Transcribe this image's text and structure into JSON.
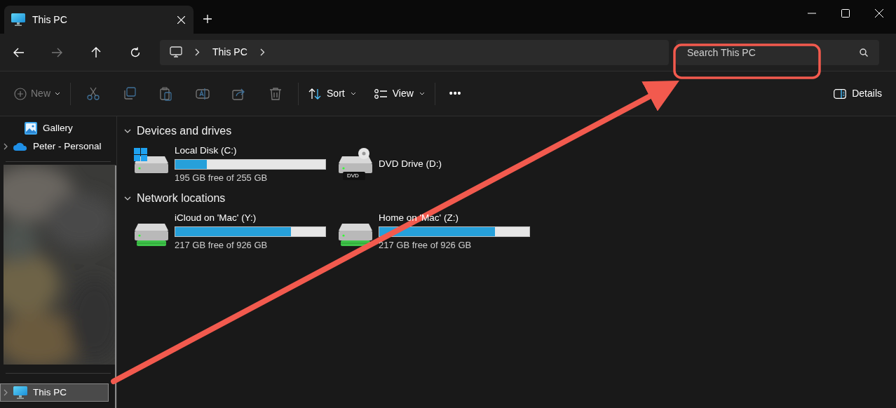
{
  "tabs": [
    {
      "title": "This PC",
      "selected": true
    }
  ],
  "address": {
    "crumbs": [
      "This PC"
    ]
  },
  "search": {
    "placeholder": "Search This PC"
  },
  "toolbar": {
    "new": "New",
    "sort": "Sort",
    "view": "View",
    "more": "•••",
    "details": "Details"
  },
  "sidebar": {
    "items": [
      {
        "label": "Gallery",
        "kind": "gallery",
        "expandable": false,
        "selected": false
      },
      {
        "label": "Peter - Personal",
        "kind": "cloud",
        "expandable": true,
        "selected": false
      }
    ],
    "bottom_items": [
      {
        "label": "This PC",
        "kind": "pc",
        "expandable": true,
        "selected": true
      }
    ]
  },
  "groups": [
    {
      "title": "Devices and drives",
      "expanded": true,
      "items": [
        {
          "name": "Local Disk (C:)",
          "kind": "system",
          "level": 0.21,
          "reading": "195 GB free of 255 GB"
        },
        {
          "name": "DVD Drive (D:)",
          "kind": "dvd",
          "badge": "DVD"
        }
      ]
    },
    {
      "title": "Network locations",
      "expanded": true,
      "items": [
        {
          "name": "iCloud on 'Mac' (Y:)",
          "kind": "network",
          "level": 0.77,
          "reading": "217 GB free of 926 GB"
        },
        {
          "name": "Home on 'Mac' (Z:)",
          "kind": "network",
          "level": 0.77,
          "reading": "217 GB free of 926 GB"
        }
      ]
    }
  ]
}
